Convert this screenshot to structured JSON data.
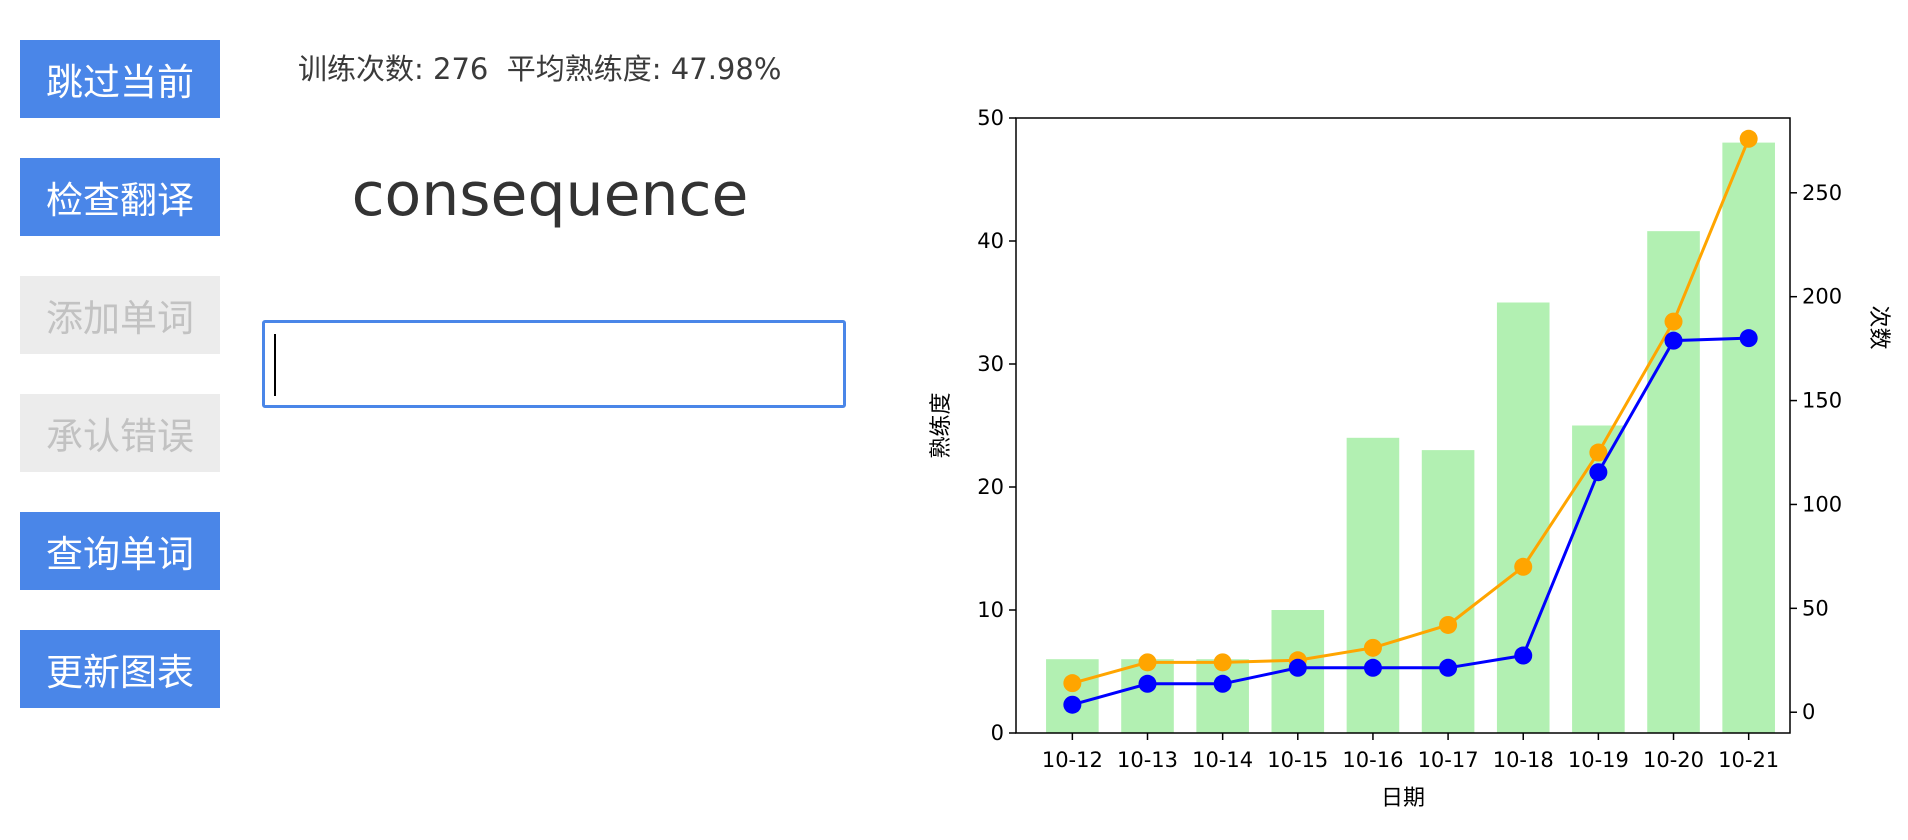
{
  "sidebar": {
    "buttons": [
      {
        "label": "跳过当前",
        "enabled": true
      },
      {
        "label": "检查翻译",
        "enabled": true
      },
      {
        "label": "添加单词",
        "enabled": false
      },
      {
        "label": "承认错误",
        "enabled": false
      },
      {
        "label": "查询单词",
        "enabled": true
      },
      {
        "label": "更新图表",
        "enabled": true
      }
    ]
  },
  "stats": {
    "count_label": "训练次数:",
    "count_value": "276",
    "avg_label": "平均熟练度:",
    "avg_value": "47.98%"
  },
  "current_word": "consequence",
  "answer_input": {
    "value": "",
    "placeholder": ""
  },
  "colors": {
    "button_active": "#4a86e8",
    "button_disabled": "#ececec",
    "bar": "#b2f0b2",
    "line_orange": "#ffa500",
    "line_blue": "#0000ff"
  },
  "chart_data": {
    "type": "bar",
    "categories": [
      "10-12",
      "10-13",
      "10-14",
      "10-15",
      "10-16",
      "10-17",
      "10-18",
      "10-19",
      "10-20",
      "10-21"
    ],
    "xlabel": "日期",
    "ylabel_left": "熟练度",
    "ylabel_right": "次数",
    "ylim_left": [
      0,
      50
    ],
    "yticks_left": [
      0,
      10,
      20,
      30,
      40,
      50
    ],
    "ylim_right": [
      -10,
      286
    ],
    "yticks_right": [
      0,
      50,
      100,
      150,
      200,
      250
    ],
    "bars_left_axis": [
      6,
      6,
      6,
      10,
      24,
      23,
      35,
      25,
      40.8,
      48
    ],
    "line_orange_right_axis": [
      14,
      24,
      24,
      25,
      31,
      42,
      70,
      125,
      188,
      276
    ],
    "line_blue_left_axis": [
      2.3,
      4,
      4,
      5.3,
      5.3,
      5.3,
      6.3,
      21.2,
      31.9,
      32.1
    ],
    "grid": false,
    "legend": "none"
  }
}
